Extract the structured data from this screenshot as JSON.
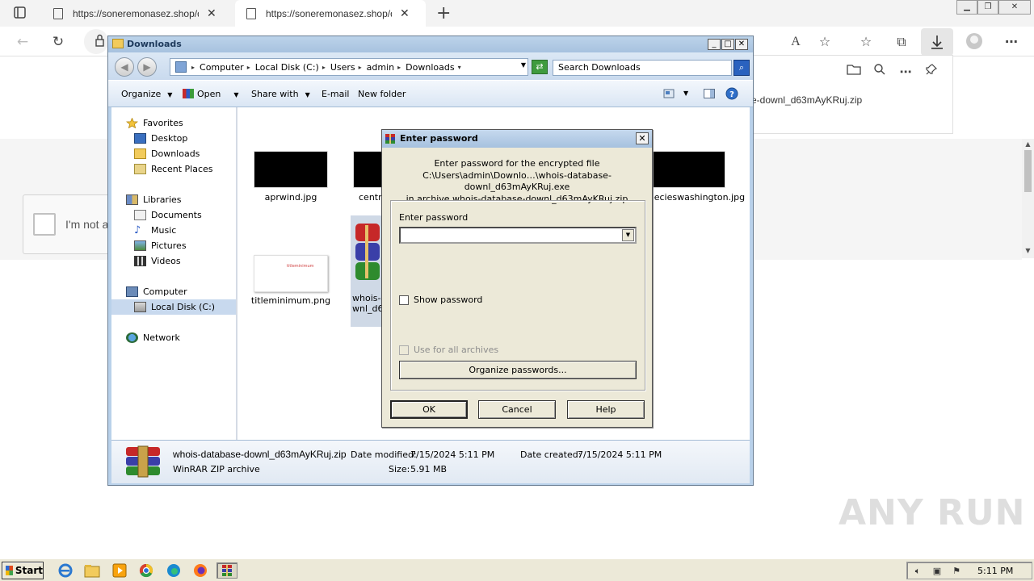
{
  "browser": {
    "tabs": [
      {
        "title": "https://soneremonasez.shop/d"
      },
      {
        "title": "https://soneremonasez.shop/d"
      }
    ],
    "new_tab_icon": "plus-icon",
    "tab_close_icon": "close-icon",
    "back_icon": "back-arrow-icon",
    "refresh_icon": "refresh-icon",
    "read_aloud_label": "A",
    "downloads_flyout": {
      "file_name": "e-downl_d63mAyKRuj.zip"
    },
    "webpage": {
      "captcha_text": "I'm not a"
    }
  },
  "explorer": {
    "title": "Downloads",
    "breadcrumbs": [
      "Computer",
      "Local Disk (C:)",
      "Users",
      "admin",
      "Downloads"
    ],
    "search_placeholder": "Search Downloads",
    "toolbar": {
      "organize": "Organize",
      "open": "Open",
      "share_with": "Share with",
      "email": "E-mail",
      "new_folder": "New folder"
    },
    "nav": {
      "favorites": "Favorites",
      "desktop": "Desktop",
      "downloads": "Downloads",
      "recent_places": "Recent Places",
      "libraries": "Libraries",
      "documents": "Documents",
      "music": "Music",
      "pictures": "Pictures",
      "videos": "Videos",
      "computer": "Computer",
      "local_disk": "Local Disk (C:)",
      "network": "Network"
    },
    "files": [
      {
        "name": "aprwind.jpg"
      },
      {
        "name": "centr"
      },
      {
        "name": "specieswashington.jpg"
      },
      {
        "name": "titleminimum.png"
      },
      {
        "name": "whois-d\nwnl_d6"
      }
    ],
    "thumb_text": "titleminimum",
    "status": {
      "file_name": "whois-database-downl_d63mAyKRuj.zip",
      "file_type": "WinRAR ZIP archive",
      "date_modified_label": "Date modified:",
      "date_modified": "7/15/2024 5:11 PM",
      "date_created_label": "Date created:",
      "date_created": "7/15/2024 5:11 PM",
      "size_label": "Size:",
      "size": "5.91 MB"
    }
  },
  "dialog": {
    "title": "Enter password",
    "message_line1": "Enter password for the encrypted file",
    "message_line2": "C:\\Users\\admin\\Downlo…\\whois-database-downl_d63mAyKRuj.exe",
    "message_line3": "in archive whois-database-downl_d63mAyKRuj.zip",
    "password_label": "Enter password",
    "password_value": "",
    "show_password_label": "Show password",
    "use_for_all_label": "Use for all archives",
    "organize_button": "Organize passwords...",
    "ok_button": "OK",
    "cancel_button": "Cancel",
    "help_button": "Help"
  },
  "watermark": "ANY RUN",
  "taskbar": {
    "start_label": "Start",
    "clock": "5:11 PM"
  }
}
